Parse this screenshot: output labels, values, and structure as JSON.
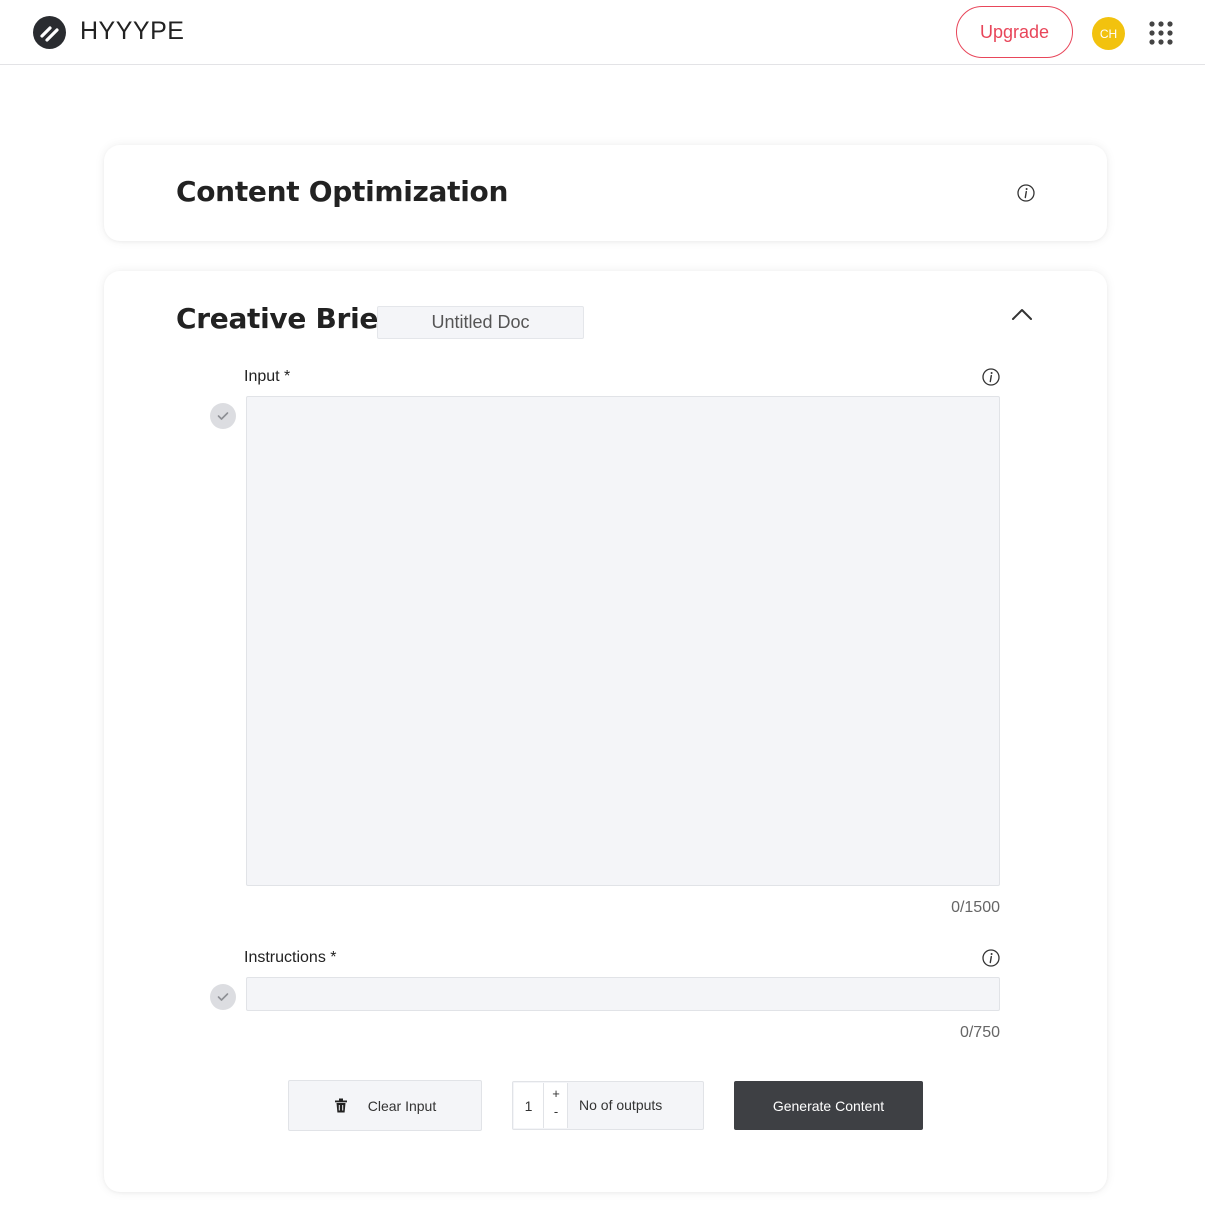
{
  "header": {
    "logo_text": "HYYYPE",
    "upgrade_label": "Upgrade",
    "avatar_initials": "CH",
    "avatar_color": "#f2c20e",
    "accent_color": "#e8465a"
  },
  "optimization_card": {
    "title": "Content Optimization",
    "info_icon": "info-icon"
  },
  "brief_card": {
    "title": "Creative Brief -",
    "doc_name": "Untitled Doc",
    "collapse_icon": "chevron-up-icon",
    "input_field": {
      "label": "Input *",
      "value": "",
      "counter": "0/1500"
    },
    "instructions_field": {
      "label": "Instructions *",
      "value": "",
      "counter": "0/750"
    },
    "clear_label": "Clear Input",
    "outputs_value": "1",
    "stepper_plus": "+",
    "stepper_minus": "-",
    "outputs_label": "No of outputs",
    "generate_label": "Generate Content",
    "generate_color": "#3e4044"
  }
}
